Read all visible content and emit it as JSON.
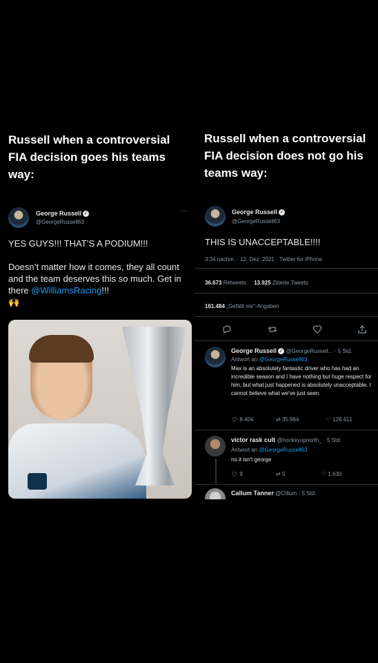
{
  "left": {
    "caption": "Russell when a controversial FIA decision goes his teams way:",
    "author_name": "George Russell",
    "author_handle": "@GeorgeRussell63",
    "more": "···",
    "text_line1": "YES GUYS!!! THAT’S A PODIUM!!!",
    "text_line2": "Doesn’t matter how it comes, they all count and the team deserves this so much. Get in there ",
    "mention": "@WilliamsRacing",
    "text_end": "!!!",
    "emoji": "🙌"
  },
  "right": {
    "caption": "Russell when a controversial FIA decision does not go his teams way:",
    "author_name": "George Russell",
    "author_handle": "@GeorgeRussell63",
    "text": "THIS IS UNACCEPTABLE!!!!",
    "timestamp": "3:34 nachm. · 12. Dez. 2021 · Twitter for iPhone",
    "retweets_count": "36.673",
    "retweets_label": "Retweets",
    "quotes_count": "13.925",
    "quotes_label": "Zitierte Tweets",
    "likes_count": "161.484",
    "likes_label": "„Gefällt mir“-Angaben",
    "icons": [
      "reply-icon",
      "retweet-icon",
      "like-icon",
      "share-icon"
    ],
    "replies": [
      {
        "name": "George Russell",
        "handle": "@GeorgeRussell...",
        "time": "· 5 Std.",
        "reply_prefix": "Antwort an",
        "reply_to": "@GeorgeRussell63",
        "text": "Max is an absolutely fantastic driver who has had an incredible season and I have nothing but huge respect for him, but what just happened is absolutely unacceptable. I cannot believe what we've just seen.",
        "replies": "8.404",
        "retweets": "35.964",
        "likes": "126.611"
      },
      {
        "name": "victor rask cult",
        "handle": "@hockeyupnorth_",
        "time": "· 5 Std.",
        "reply_prefix": "Antwort an",
        "reply_to": "@GeorgeRussell63",
        "text": "no it isn't george",
        "replies": "9",
        "retweets": "5",
        "likes": "1.630"
      },
      {
        "name": "Callum Tanner",
        "handle": "@Ctllum",
        "time": "· 5 Std."
      }
    ]
  },
  "colors": {
    "background": "#000000",
    "text": "#e7e9ea",
    "muted": "#8b98a5",
    "link": "#1d9bf0",
    "divider": "#2f3336"
  }
}
